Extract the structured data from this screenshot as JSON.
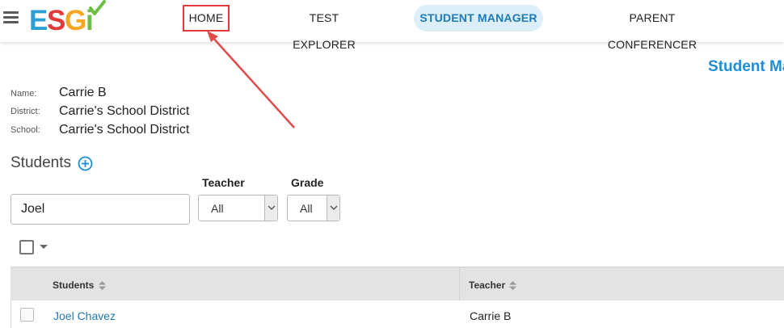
{
  "app": {
    "logo_letters": [
      "E",
      "S",
      "G",
      "i"
    ],
    "colors": {
      "logo_e": "#2a9fd8",
      "logo_s": "#e23a3a",
      "logo_g": "#f5a623",
      "logo_i": "#6cbe45",
      "accent": "#1d8ed6",
      "annotation": "#e03c3c"
    }
  },
  "nav": {
    "menu_icon": "hamburger-icon",
    "items": [
      {
        "label": "HOME",
        "highlighted_by_annotation": true
      },
      {
        "label": "TEST EXPLORER"
      },
      {
        "label": "STUDENT MANAGER",
        "active": true
      },
      {
        "label": "PARENT CONFERENCER"
      }
    ]
  },
  "page": {
    "title": "Student Ma"
  },
  "info": {
    "name_label": "Name:",
    "name_value": "Carrie B",
    "district_label": "District:",
    "district_value": "Carrie's School District",
    "school_label": "School:",
    "school_value": "Carrie's School District"
  },
  "students": {
    "heading": "Students",
    "add_icon": "plus-circle-icon"
  },
  "filters": {
    "search_value": "Joel",
    "teacher_label": "Teacher",
    "teacher_selected": "All",
    "grade_label": "Grade",
    "grade_selected": "All"
  },
  "table": {
    "columns": [
      "Students",
      "Teacher"
    ],
    "rows": [
      {
        "student": "Joel Chavez",
        "teacher": "Carrie B"
      }
    ]
  }
}
